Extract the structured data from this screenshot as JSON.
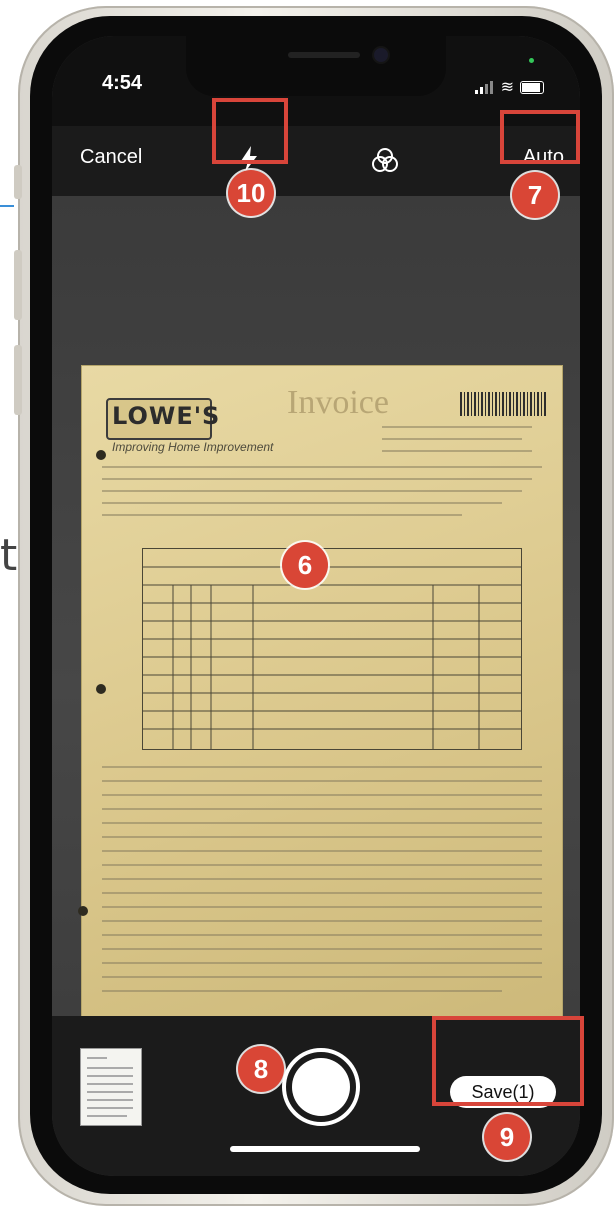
{
  "status": {
    "time": "4:54"
  },
  "toolbar": {
    "cancel_label": "Cancel",
    "auto_label": "Auto"
  },
  "document": {
    "title": "Invoice",
    "logo": "LOWE'S",
    "tagline": "Improving Home Improvement"
  },
  "bottom": {
    "save_label": "Save(1)"
  },
  "callouts": {
    "c6": "6",
    "c7": "7",
    "c8": "8",
    "c9": "9",
    "c10": "10"
  },
  "colors": {
    "highlight": "#d8453a",
    "callout": "#d94636"
  }
}
